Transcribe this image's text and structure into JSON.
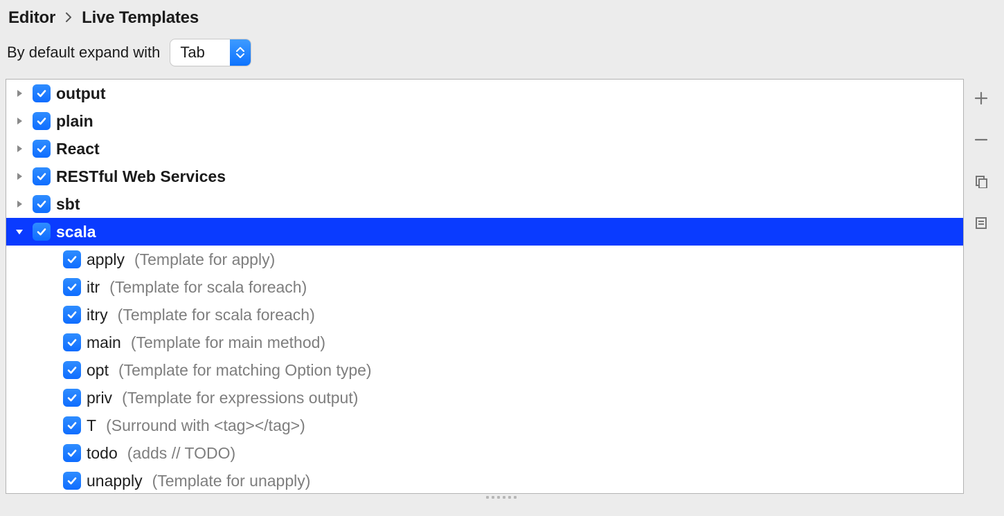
{
  "breadcrumb": {
    "section": "Editor",
    "page": "Live Templates"
  },
  "expand": {
    "label": "By default expand with",
    "value": "Tab"
  },
  "groups": [
    {
      "name": "output",
      "expanded": false,
      "checked": true,
      "selected": false
    },
    {
      "name": "plain",
      "expanded": false,
      "checked": true,
      "selected": false
    },
    {
      "name": "React",
      "expanded": false,
      "checked": true,
      "selected": false
    },
    {
      "name": "RESTful Web Services",
      "expanded": false,
      "checked": true,
      "selected": false
    },
    {
      "name": "sbt",
      "expanded": false,
      "checked": true,
      "selected": false
    },
    {
      "name": "scala",
      "expanded": true,
      "checked": true,
      "selected": true,
      "items": [
        {
          "name": "apply",
          "desc": "(Template for apply)",
          "checked": true
        },
        {
          "name": "itr",
          "desc": "(Template for scala foreach)",
          "checked": true
        },
        {
          "name": "itry",
          "desc": "(Template for scala foreach)",
          "checked": true
        },
        {
          "name": "main",
          "desc": "(Template for main method)",
          "checked": true
        },
        {
          "name": "opt",
          "desc": "(Template for matching Option type)",
          "checked": true
        },
        {
          "name": "priv",
          "desc": "(Template for expressions output)",
          "checked": true
        },
        {
          "name": "T",
          "desc": "(Surround with <tag></tag>)",
          "checked": true
        },
        {
          "name": "todo",
          "desc": "(adds // TODO)",
          "checked": true
        },
        {
          "name": "unapply",
          "desc": "(Template for unapply)",
          "checked": true
        }
      ]
    }
  ]
}
